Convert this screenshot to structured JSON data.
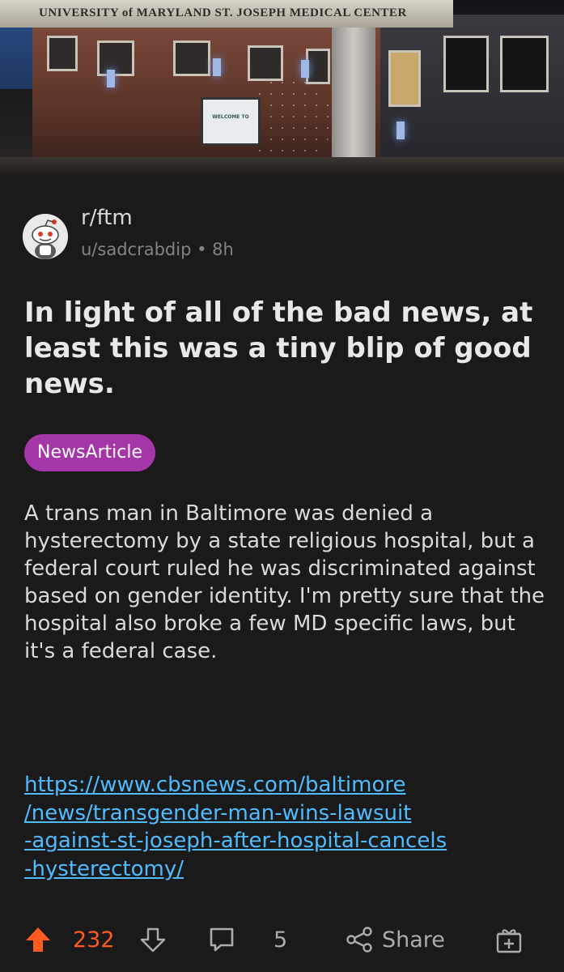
{
  "hero": {
    "sign_text": "UNIVERSITY of MARYLAND ST. JOSEPH MEDICAL CENTER",
    "welcome_sign": "WELCOME TO"
  },
  "post": {
    "subreddit": "r/ftm",
    "author": "u/sadcrabdip",
    "separator": "•",
    "age": "8h",
    "title": "In light of all of the bad news, at least this was a tiny blip of good news.",
    "flair": "NewsArticle",
    "body": "A trans man in Baltimore was denied a hysterectomy by a state religious hospital, but a federal court ruled he was discriminated against based on gender identity. I'm pretty sure that the hospital also broke a few MD specific laws, but it's a federal case.",
    "link_lines": [
      "https://www.cbsnews.com/baltimore",
      "/news/transgender-man-wins-lawsuit",
      "-against-st-joseph-after-hospital-cancels",
      "-hysterectomy/"
    ]
  },
  "actions": {
    "score": "232",
    "comments": "5",
    "share_label": "Share"
  },
  "colors": {
    "background": "#1a1a1b",
    "upvote_active": "#ff5a1f",
    "flair": "#a436a7",
    "link": "#4fbcff"
  },
  "icons": [
    "upvote-icon",
    "downvote-icon",
    "comment-icon",
    "share-icon",
    "award-icon"
  ]
}
